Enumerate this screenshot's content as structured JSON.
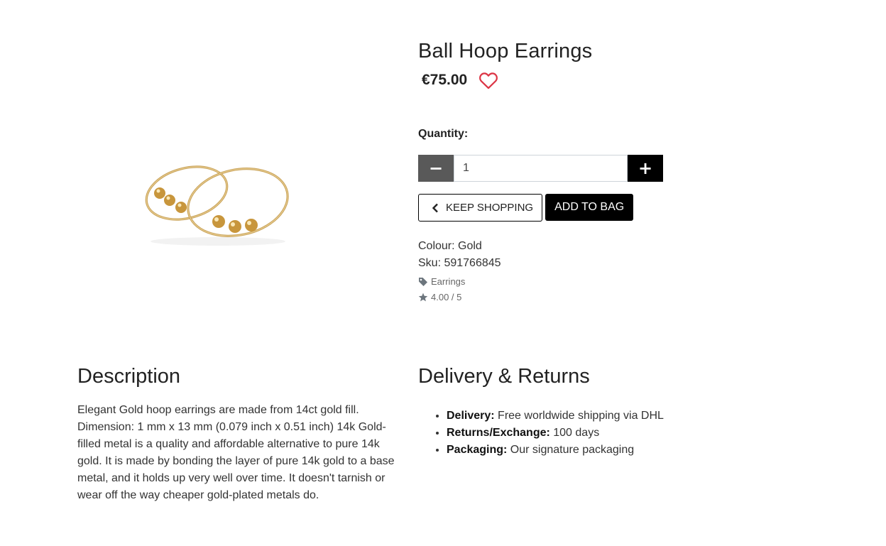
{
  "product": {
    "title": "Ball Hoop Earrings",
    "price": "€75.00",
    "wishlist_icon": "heart-outline-icon",
    "wishlist_color": "#dc3545"
  },
  "quantity": {
    "label": "Quantity:",
    "value": "1",
    "decrement_symbol": "−",
    "increment_symbol": "+"
  },
  "actions": {
    "keep_shopping": "KEEP SHOPPING",
    "add_to_bag": "ADD TO BAG"
  },
  "details": {
    "colour": "Colour: Gold",
    "sku": "Sku: 591766845",
    "category": "Earrings",
    "rating": "4.00 / 5"
  },
  "description": {
    "heading": "Description",
    "text": "Elegant Gold hoop earrings are made from 14ct gold fill. Dimension: 1 mm x 13 mm (0.079 inch x 0.51 inch) 14k Gold-filled metal is a quality and affordable alternative to pure 14k gold. It is made by bonding the layer of pure 14k gold to a base metal, and it holds up very well over time. It doesn't tarnish or wear off the way cheaper gold-plated metals do."
  },
  "delivery": {
    "heading": "Delivery & Returns",
    "items": [
      {
        "label": "Delivery:",
        "value": " Free worldwide shipping via DHL"
      },
      {
        "label": "Returns/Exchange:",
        "value": " 100 days"
      },
      {
        "label": "Packaging:",
        "value": " Our signature packaging"
      }
    ]
  }
}
